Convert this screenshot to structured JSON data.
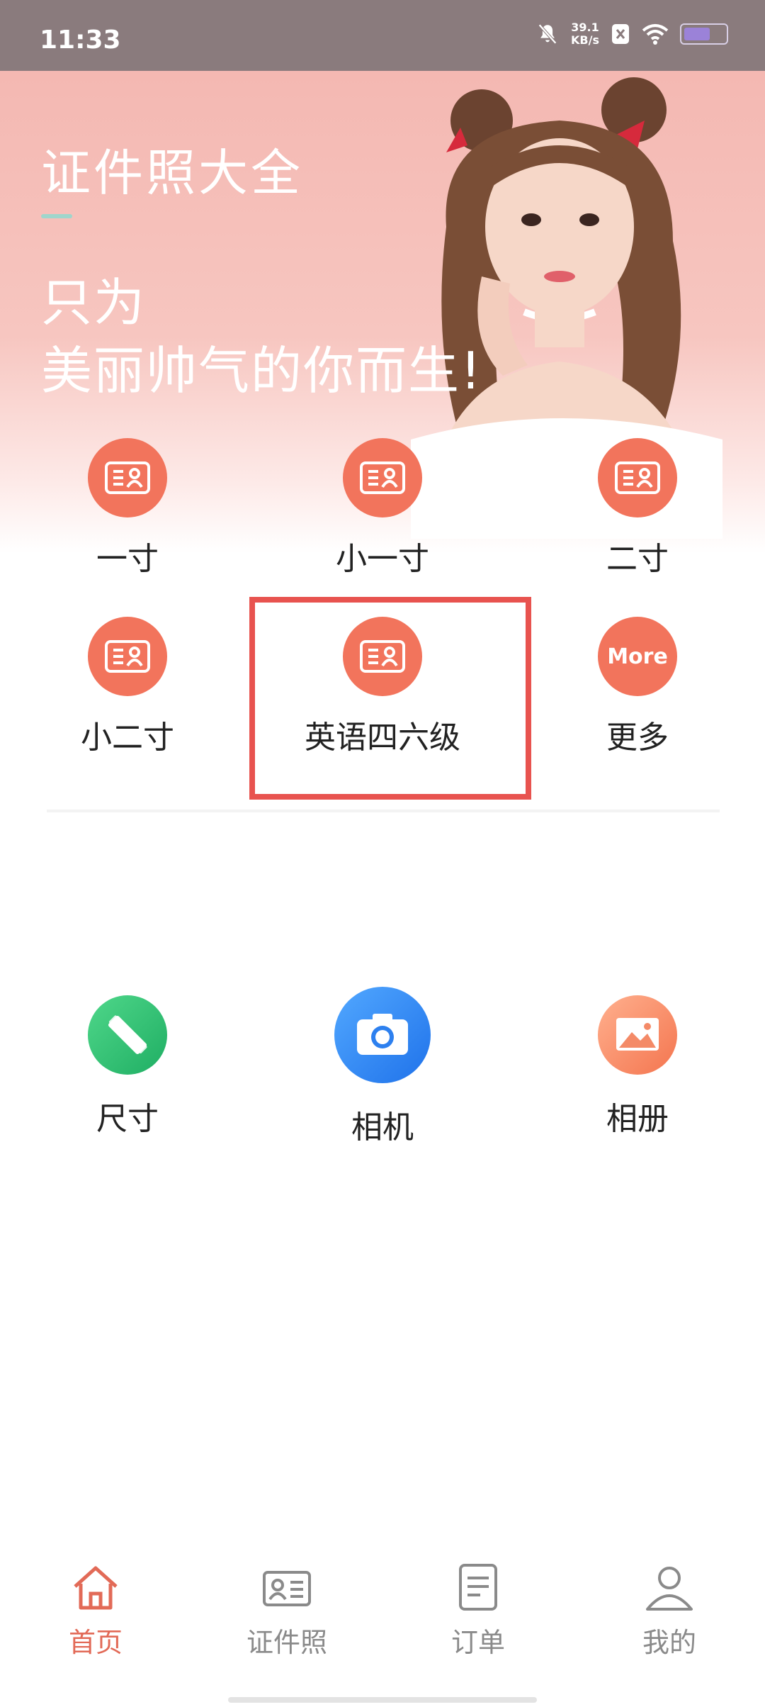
{
  "status_bar": {
    "time": "11:33",
    "speed_value": "39.1",
    "speed_unit": "KB/s"
  },
  "hero": {
    "title": "证件照大全",
    "line1": "只为",
    "line2": "美丽帅气的你而生!"
  },
  "photo_types": [
    {
      "label": "一寸"
    },
    {
      "label": "小一寸"
    },
    {
      "label": "二寸"
    },
    {
      "label": "小二寸"
    },
    {
      "label": "英语四六级"
    },
    {
      "label": "更多",
      "icon_text": "More"
    }
  ],
  "tools": [
    {
      "label": "尺寸",
      "icon": "ruler-pencil-icon"
    },
    {
      "label": "相机",
      "icon": "camera-icon"
    },
    {
      "label": "相册",
      "icon": "gallery-icon"
    }
  ],
  "nav": [
    {
      "label": "首页",
      "icon": "home-icon",
      "active": true
    },
    {
      "label": "证件照",
      "icon": "id-card-icon"
    },
    {
      "label": "订单",
      "icon": "order-icon"
    },
    {
      "label": "我的",
      "icon": "user-icon"
    }
  ],
  "colors": {
    "accent": "#f2745c",
    "nav_active": "#e26a57",
    "highlight": "#e8534f",
    "status_bar": "#8a7b7d"
  }
}
